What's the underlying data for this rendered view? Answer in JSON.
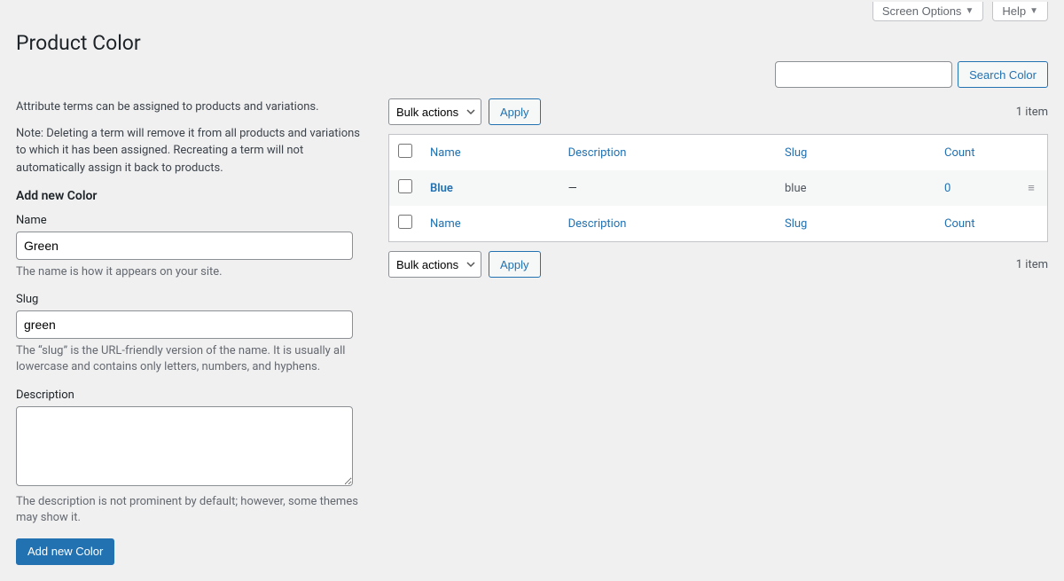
{
  "topbar": {
    "screen_options": "Screen Options",
    "help": "Help"
  },
  "title": "Product Color",
  "search": {
    "button": "Search Color"
  },
  "left": {
    "intro": "Attribute terms can be assigned to products and variations.",
    "note": "Note: Deleting a term will remove it from all products and variations to which it has been assigned. Recreating a term will not automatically assign it back to products.",
    "add_heading": "Add new Color",
    "name_label": "Name",
    "name_value": "Green",
    "name_desc": "The name is how it appears on your site.",
    "slug_label": "Slug",
    "slug_value": "green",
    "slug_desc": "The “slug” is the URL-friendly version of the name. It is usually all lowercase and contains only letters, numbers, and hyphens.",
    "desc_label": "Description",
    "desc_value": "",
    "desc_desc": "The description is not prominent by default; however, some themes may show it.",
    "submit": "Add new Color"
  },
  "table": {
    "bulk_label": "Bulk actions",
    "apply": "Apply",
    "item_count": "1 item",
    "col_name": "Name",
    "col_description": "Description",
    "col_slug": "Slug",
    "col_count": "Count",
    "rows": [
      {
        "name": "Blue",
        "description": "—",
        "slug": "blue",
        "count": "0"
      }
    ]
  }
}
